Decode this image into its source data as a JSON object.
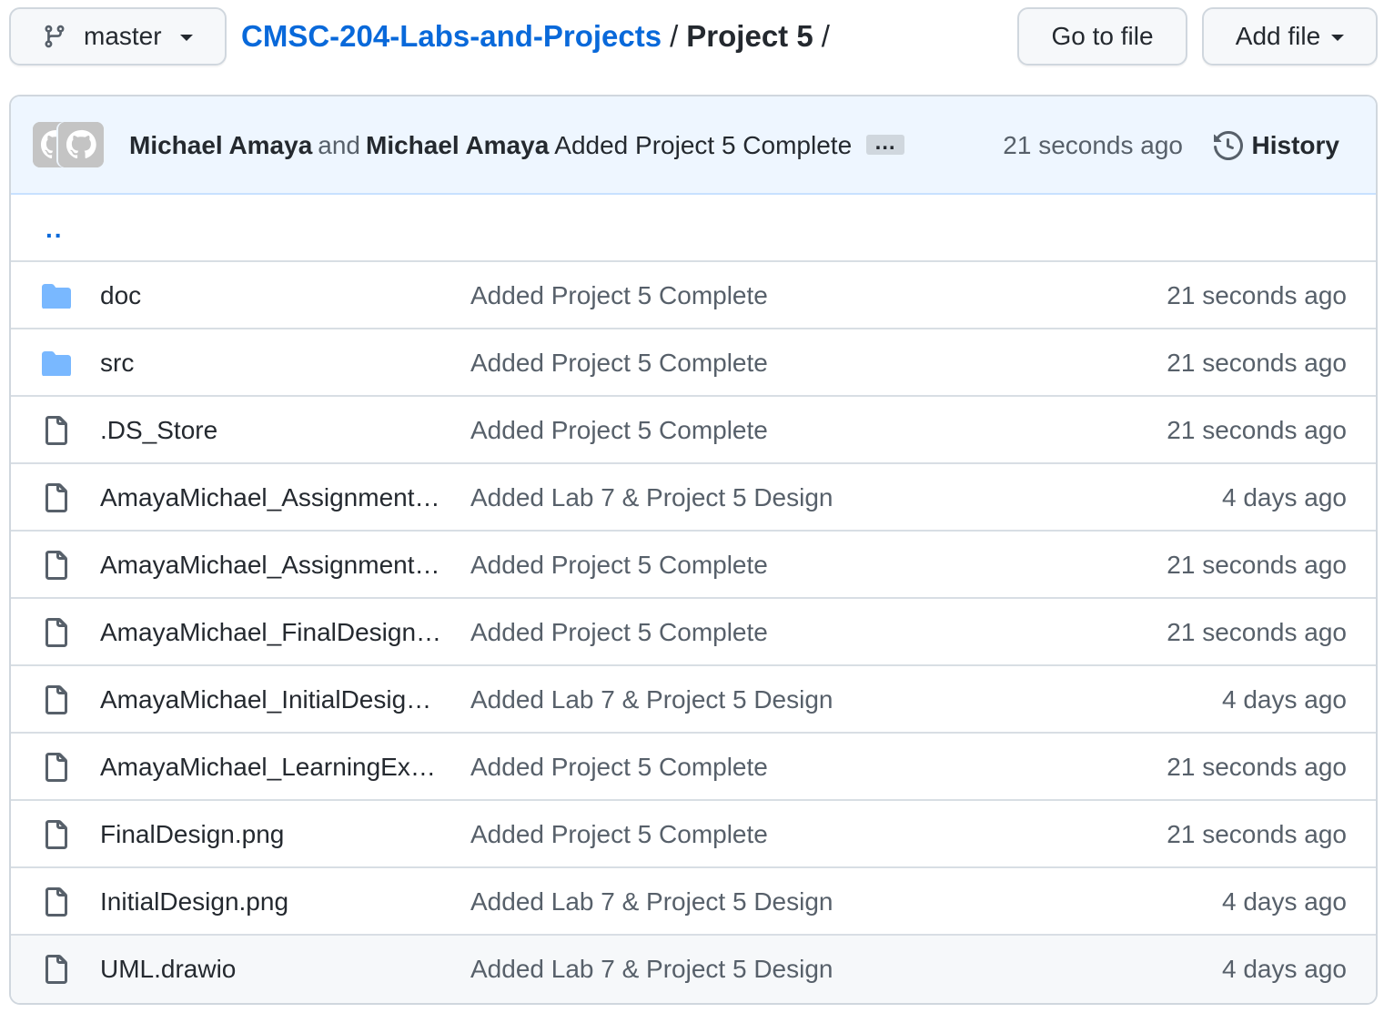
{
  "branch": {
    "name": "master",
    "icon": "git-branch-icon"
  },
  "breadcrumb": {
    "repo": "CMSC-204-Labs-and-Projects",
    "separator": "/",
    "current": "Project 5",
    "trailing": "/"
  },
  "actions": {
    "go_to_file": "Go to file",
    "add_file": "Add file"
  },
  "commit": {
    "author1": "Michael Amaya",
    "joiner": "and",
    "author2": "Michael Amaya",
    "message": "Added Project 5 Complete",
    "ellipsis": "…",
    "time": "21 seconds ago",
    "history_label": "History",
    "history_icon": "history-icon"
  },
  "parent_dir": "..",
  "files": [
    {
      "type": "folder",
      "icon": "folder-icon",
      "name": "doc",
      "message": "Added Project 5 Complete",
      "age": "21 seconds ago"
    },
    {
      "type": "folder",
      "icon": "folder-icon",
      "name": "src",
      "message": "Added Project 5 Complete",
      "age": "21 seconds ago"
    },
    {
      "type": "file",
      "icon": "file-icon",
      "name": ".DS_Store",
      "message": "Added Project 5 Complete",
      "age": "21 seconds ago"
    },
    {
      "type": "file",
      "icon": "file-icon",
      "name": "AmayaMichael_Assignment…",
      "message": "Added Lab 7 & Project 5 Design",
      "age": "4 days ago"
    },
    {
      "type": "file",
      "icon": "file-icon",
      "name": "AmayaMichael_Assignment…",
      "message": "Added Project 5 Complete",
      "age": "21 seconds ago"
    },
    {
      "type": "file",
      "icon": "file-icon",
      "name": "AmayaMichael_FinalDesign…",
      "message": "Added Project 5 Complete",
      "age": "21 seconds ago"
    },
    {
      "type": "file",
      "icon": "file-icon",
      "name": "AmayaMichael_InitialDesig…",
      "message": "Added Lab 7 & Project 5 Design",
      "age": "4 days ago"
    },
    {
      "type": "file",
      "icon": "file-icon",
      "name": "AmayaMichael_LearningEx…",
      "message": "Added Project 5 Complete",
      "age": "21 seconds ago"
    },
    {
      "type": "file",
      "icon": "file-icon",
      "name": "FinalDesign.png",
      "message": "Added Project 5 Complete",
      "age": "21 seconds ago"
    },
    {
      "type": "file",
      "icon": "file-icon",
      "name": "InitialDesign.png",
      "message": "Added Lab 7 & Project 5 Design",
      "age": "4 days ago"
    },
    {
      "type": "file",
      "icon": "file-icon",
      "name": "UML.drawio",
      "message": "Added Lab 7 & Project 5 Design",
      "age": "4 days ago"
    }
  ],
  "colors": {
    "link": "#0969da",
    "folder": "#79b8ff",
    "muted": "#57606a",
    "commit_bar_bg": "#eef6ff"
  }
}
